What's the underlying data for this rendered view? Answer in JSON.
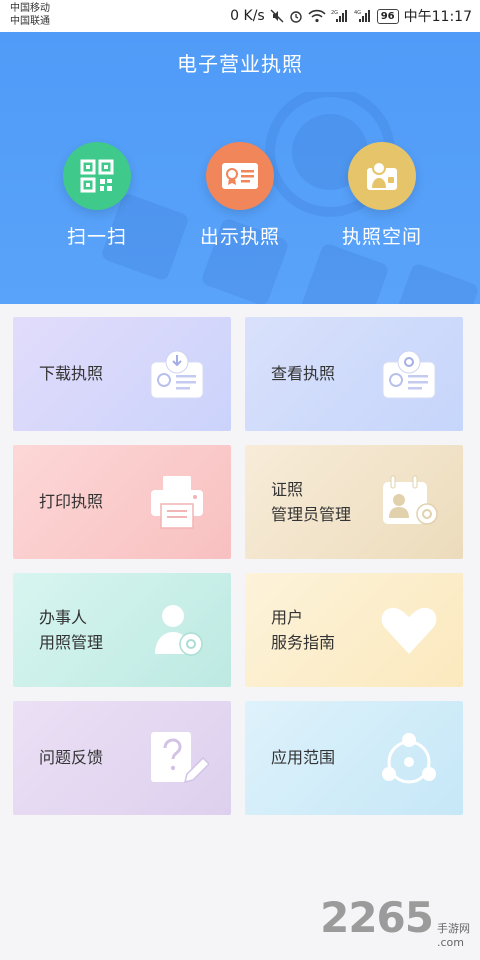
{
  "status_bar": {
    "carrier_1": "中国移动",
    "carrier_2": "中国联通",
    "speed": "0 K/s",
    "battery": "96",
    "time": "中午11:17",
    "signal_tag_1": "2G",
    "signal_tag_2": "4G"
  },
  "header": {
    "title": "电子营业执照",
    "actions": [
      {
        "label": "扫一扫",
        "icon": "qr-code-icon",
        "color": "#3fc98a"
      },
      {
        "label": "出示执照",
        "icon": "license-card-icon",
        "color": "#f0865a"
      },
      {
        "label": "执照空间",
        "icon": "license-space-icon",
        "color": "#e6c46a"
      }
    ]
  },
  "grid": {
    "items": [
      {
        "line1": "下载执照",
        "line2": "",
        "icon": "download-license-icon"
      },
      {
        "line1": "查看执照",
        "line2": "",
        "icon": "view-license-icon"
      },
      {
        "line1": "打印执照",
        "line2": "",
        "icon": "printer-icon"
      },
      {
        "line1": "证照",
        "line2": "管理员管理",
        "icon": "admin-calendar-icon"
      },
      {
        "line1": "办事人",
        "line2": "用照管理",
        "icon": "user-settings-icon"
      },
      {
        "line1": "用户",
        "line2": "服务指南",
        "icon": "heart-icon"
      },
      {
        "line1": "问题反馈",
        "line2": "",
        "icon": "feedback-icon"
      },
      {
        "line1": "应用范围",
        "line2": "",
        "icon": "scope-icon"
      }
    ]
  },
  "watermark": {
    "number": "2265",
    "site_cn": "手游网",
    "site_en": ".com"
  }
}
